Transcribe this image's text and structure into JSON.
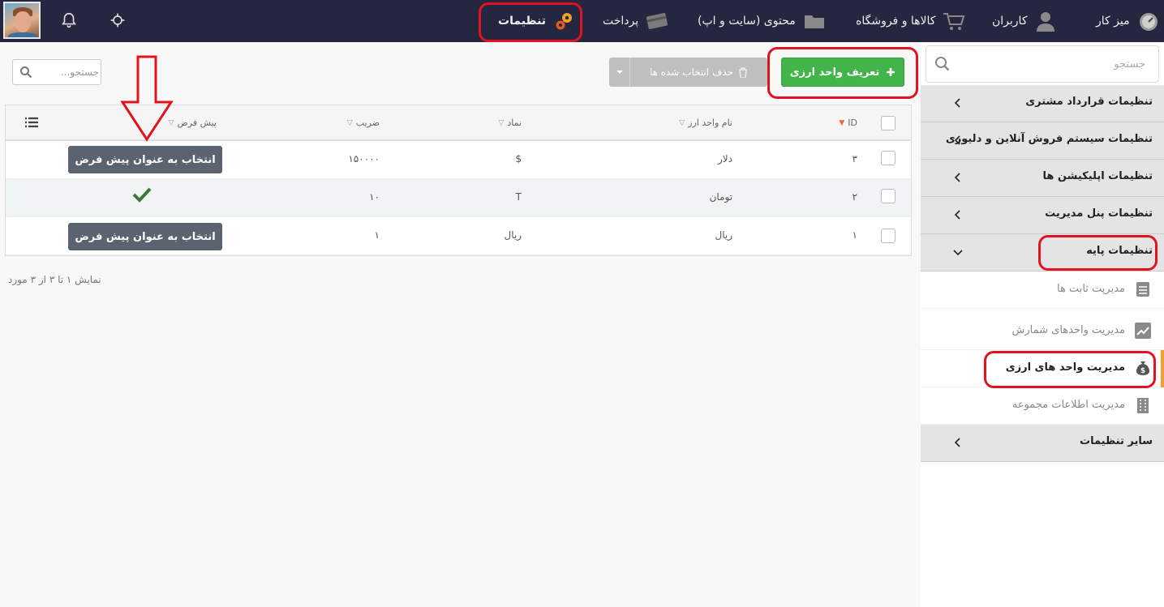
{
  "topnav": {
    "items": [
      {
        "label": "تنظیمات",
        "icon": "gears-icon"
      },
      {
        "label": "پرداخت",
        "icon": "credit-card-icon"
      },
      {
        "label": "محتوی (سایت و اپ)",
        "icon": "folder-icon"
      },
      {
        "label": "کالاها و فروشگاه",
        "icon": "cart-icon"
      },
      {
        "label": "کاربران",
        "icon": "user-icon"
      },
      {
        "label": "میز کار",
        "icon": "dashboard-icon"
      }
    ],
    "active_index": 0
  },
  "sidebar": {
    "search_placeholder": "جستجو",
    "groups_before": [
      "تنظیمات قرارداد مشتری",
      "تنظیمات سیستم فروش آنلاین و دلیوری",
      "تنظیمات اپلیکیشن ها",
      "تنظیمات پنل مدیریت"
    ],
    "open_group": "تنظیمات پایه",
    "sub_items": [
      {
        "label": "مدیریت ثابت ها",
        "icon": "list-doc-icon",
        "active": false
      },
      {
        "label": "مدیریت واحدهای شمارش",
        "icon": "chart-line-icon",
        "active": false
      },
      {
        "label": "مدیریت واحد های ارزی",
        "icon": "money-bag-icon",
        "active": true
      },
      {
        "label": "مدیریت اطلاعات مجموعه",
        "icon": "building-icon",
        "active": false
      }
    ],
    "groups_after": [
      "سایر تنظیمات"
    ]
  },
  "toolbar": {
    "add_label": "تعریف واحد ارزی",
    "delete_label": "حذف انتخاب شده ها",
    "search_placeholder": "جستجو..."
  },
  "table": {
    "columns": {
      "id": "ID",
      "name": "نام واحد ارز",
      "symbol": "نماد",
      "factor": "ضریب",
      "default": "پیش فرض"
    },
    "rows": [
      {
        "id": "۳",
        "name": "دلار",
        "symbol": "$",
        "factor": "۱۵۰۰۰۰",
        "is_default": false
      },
      {
        "id": "۲",
        "name": "تومان",
        "symbol": "T",
        "factor": "۱۰",
        "is_default": true
      },
      {
        "id": "۱",
        "name": "ریال",
        "symbol": "ریال",
        "factor": "۱",
        "is_default": false
      }
    ],
    "set_default_label": "انتخاب به عنوان پیش فرض",
    "footer": "نمایش ۱ تا ۳ از ۳ مورد"
  },
  "colors": {
    "nav_bg": "#252640",
    "accent_green": "#41b549",
    "highlight_red": "#e0131e",
    "active_marker": "#f0a030"
  }
}
